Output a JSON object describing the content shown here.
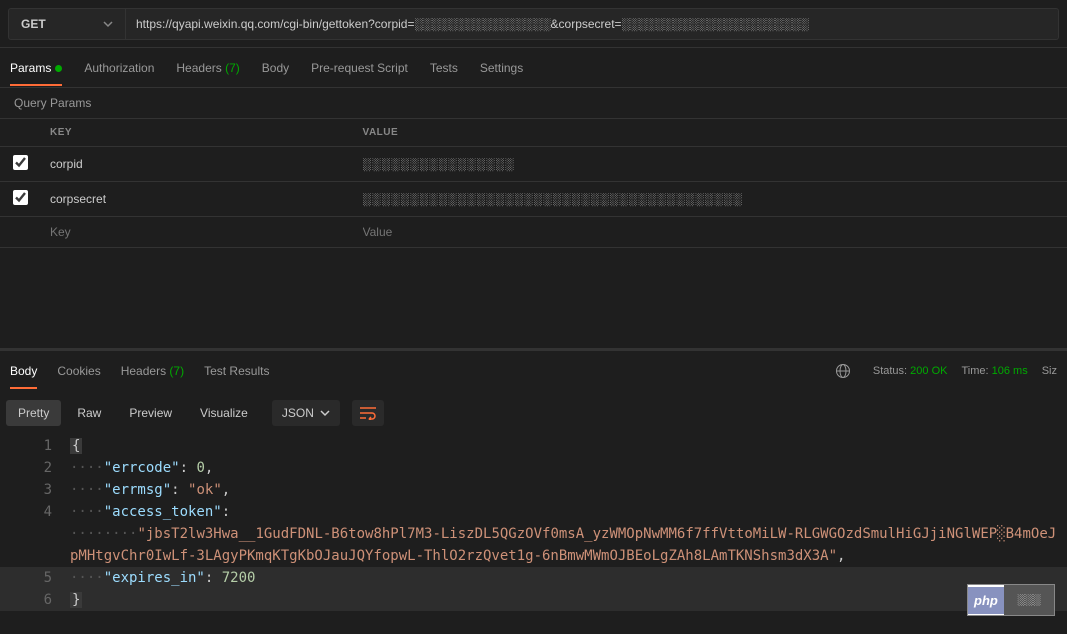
{
  "request": {
    "method": "GET",
    "url": "https://qyapi.weixin.qq.com/cgi-bin/gettoken?corpid=░░░░░░░░░░░░░░░░&corpsecret=░░░░░░░░░░░░░░░░░░░░░░"
  },
  "tabs": {
    "params": "Params",
    "auth": "Authorization",
    "headers": "Headers",
    "headers_count": "(7)",
    "body": "Body",
    "prerequest": "Pre-request Script",
    "tests": "Tests",
    "settings": "Settings"
  },
  "section_title": "Query Params",
  "params_headers": {
    "key": "KEY",
    "value": "VALUE"
  },
  "params": [
    {
      "key": "corpid",
      "value": "░░░░░░░░░░░░░░░░"
    },
    {
      "key": "corpsecret",
      "value": "░░░░░░░░░░░░░░░░░░░░░░░░░░░░░░░░░░░░░░░░"
    }
  ],
  "params_placeholder": {
    "key": "Key",
    "value": "Value"
  },
  "resp_tabs": {
    "body": "Body",
    "cookies": "Cookies",
    "headers": "Headers",
    "headers_count": "(7)",
    "test": "Test Results"
  },
  "status": {
    "label": "Status:",
    "code": "200 OK",
    "time_label": "Time:",
    "time": "106 ms",
    "size_label": "Siz"
  },
  "view": {
    "pretty": "Pretty",
    "raw": "Raw",
    "preview": "Preview",
    "visualize": "Visualize",
    "format": "JSON"
  },
  "json_body": {
    "errcode": 0,
    "errmsg": "ok",
    "access_token": "jbsT2lw3Hwa__1GudFDNL-B6tow8hPl7M3-LiszDL5QGzOVf0msA_yzWMOpNwMM6f7ffVttoMiLW-RLGWGOzdSmulHiGJjiNGlWEP░B4mOeJpMHtgvChr0IwLf-3LAgyPKmqKTgKbOJauJQYfopwL-ThlO2rzQvet1g-6nBmwMWmOJBEoLgZAh8LAmTKNShsm3dX3A",
    "expires_in": 7200
  },
  "badge": {
    "left": "php",
    "right": "░░░"
  }
}
